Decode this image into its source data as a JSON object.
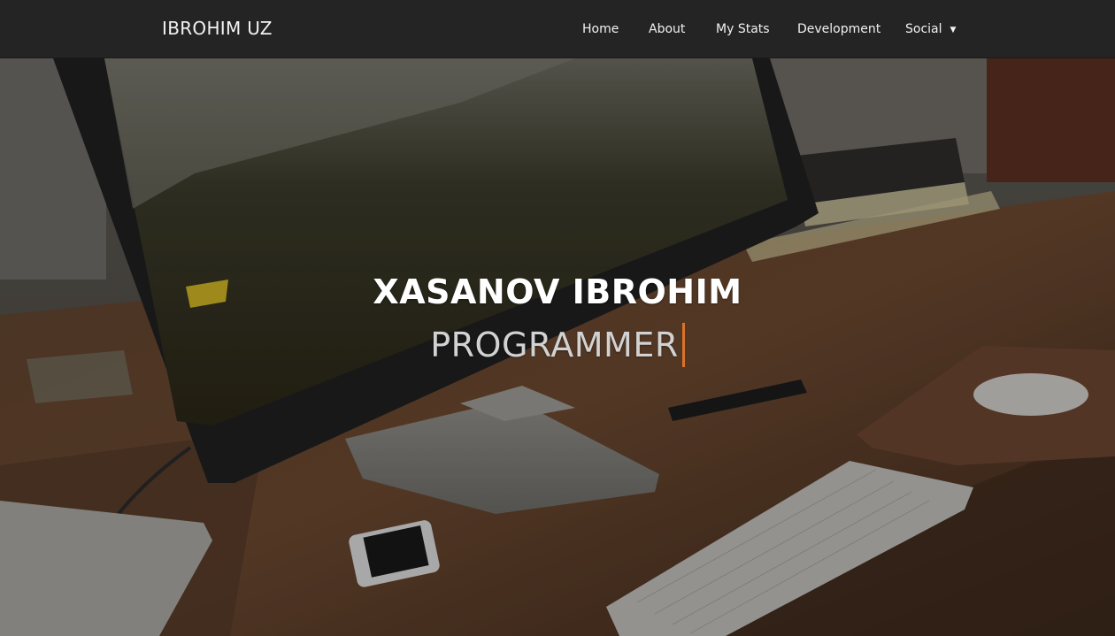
{
  "navbar": {
    "brand": "IBROHIM UZ",
    "items": [
      {
        "label": "Home"
      },
      {
        "label": "About"
      },
      {
        "label": "My Stats"
      },
      {
        "label": "Development"
      },
      {
        "label": "Social",
        "has_dropdown": true
      }
    ],
    "dropdown_caret": "▼"
  },
  "hero": {
    "title": "XASANOV IBROHIM",
    "subtitle": "PROGRAMMER",
    "cursor_color": "#d9732a"
  },
  "colors": {
    "navbar_bg": "#242424",
    "nav_text": "#f1f1f1",
    "title_text": "#ffffff",
    "subtitle_text": "#d2d2d2"
  }
}
